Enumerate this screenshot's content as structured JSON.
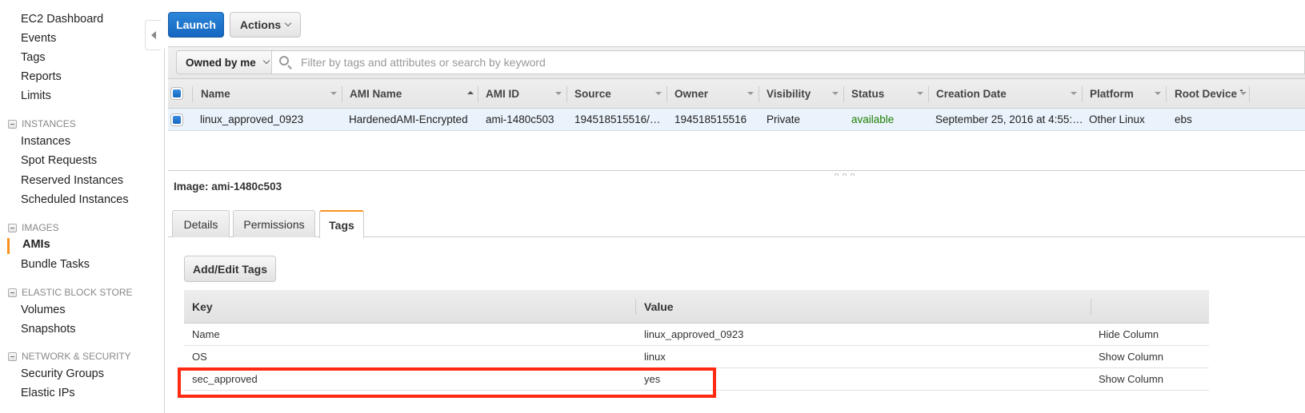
{
  "sidebar": {
    "top_items": [
      "EC2 Dashboard",
      "Events",
      "Tags",
      "Reports",
      "Limits"
    ],
    "sections": [
      {
        "title": "INSTANCES",
        "items": [
          "Instances",
          "Spot Requests",
          "Reserved Instances",
          "Scheduled Instances"
        ]
      },
      {
        "title": "IMAGES",
        "items": [
          "AMIs",
          "Bundle Tasks"
        ],
        "active": "AMIs"
      },
      {
        "title": "ELASTIC BLOCK STORE",
        "items": [
          "Volumes",
          "Snapshots"
        ]
      },
      {
        "title": "NETWORK & SECURITY",
        "items": [
          "Security Groups",
          "Elastic IPs"
        ]
      }
    ],
    "accent_color": "#f7931e"
  },
  "toolbar": {
    "launch_label": "Launch",
    "actions_label": "Actions",
    "launch_color": "#1a6fca"
  },
  "filter": {
    "owner_select": "Owned by me",
    "search_placeholder": "Filter by tags and attributes or search by keyword",
    "search_value": ""
  },
  "grid": {
    "columns": [
      "Name",
      "AMI Name",
      "AMI ID",
      "Source",
      "Owner",
      "Visibility",
      "Status",
      "Creation Date",
      "Platform",
      "Root Device T"
    ],
    "sorted_column": "AMI Name",
    "rows": [
      {
        "selected": true,
        "cells": [
          "linux_approved_0923",
          "HardenedAMI-Encrypted",
          "ami-1480c503",
          "194518515516/…",
          "194518515516",
          "Private",
          "available",
          "September 25, 2016 at 4:55:…",
          "Other Linux",
          "ebs"
        ]
      }
    ],
    "status_color": "#1d8102"
  },
  "detail": {
    "title": "Image: ami-1480c503",
    "tabs": [
      {
        "label": "Details",
        "active": false
      },
      {
        "label": "Permissions",
        "active": false
      },
      {
        "label": "Tags",
        "active": true
      }
    ],
    "add_edit_label": "Add/Edit Tags",
    "tags_table": {
      "headers": [
        "Key",
        "Value",
        ""
      ],
      "rows": [
        {
          "key": "Name",
          "value": "linux_approved_0923",
          "action": "Hide Column"
        },
        {
          "key": "OS",
          "value": "linux",
          "action": "Show Column"
        },
        {
          "key": "sec_approved",
          "value": "yes",
          "action": "Show Column",
          "highlighted": true
        }
      ]
    },
    "highlight_color": "#ff2a12"
  }
}
